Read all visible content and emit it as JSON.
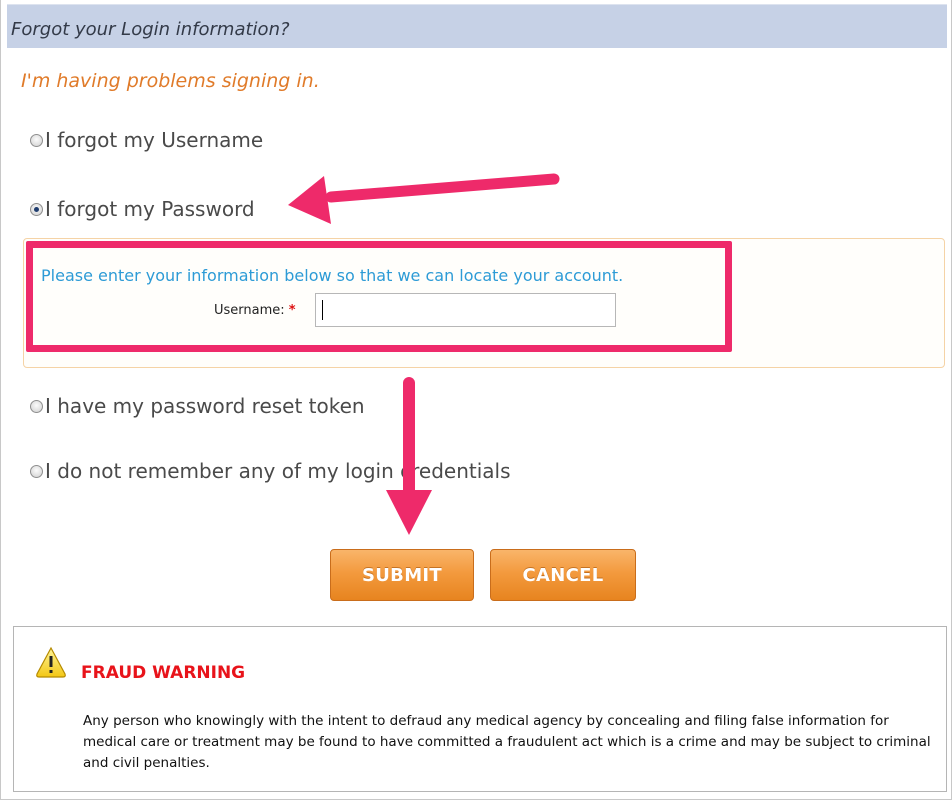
{
  "header": {
    "title": "Forgot your Login information?"
  },
  "subtitle": "I'm having problems signing in.",
  "options": [
    {
      "label": "I forgot my Username",
      "checked": false
    },
    {
      "label": "I forgot my Password",
      "checked": true
    },
    {
      "label": "I have my password reset token",
      "checked": false
    },
    {
      "label": "I do not remember any of my login credentials",
      "checked": false
    }
  ],
  "info": {
    "text": "Please enter your information below so that we can locate your account.",
    "username_label": "Username:",
    "required_mark": "*",
    "username_value": ""
  },
  "buttons": {
    "submit": "SUBMIT",
    "cancel": "CANCEL"
  },
  "warning": {
    "title": "FRAUD WARNING",
    "text": "Any person who knowingly with the intent to defraud any medical agency by concealing and filing false information for medical care or treatment may be found to have committed a fraudulent act which is a crime and may be subject to criminal and civil penalties."
  },
  "colors": {
    "header_bg": "#c6d1e6",
    "subtitle": "#e07b2a",
    "info_text": "#2d9bd6",
    "annotation": "#ee2a6a",
    "button_orange": "#f39a3e",
    "warning_red": "#e8131a"
  }
}
